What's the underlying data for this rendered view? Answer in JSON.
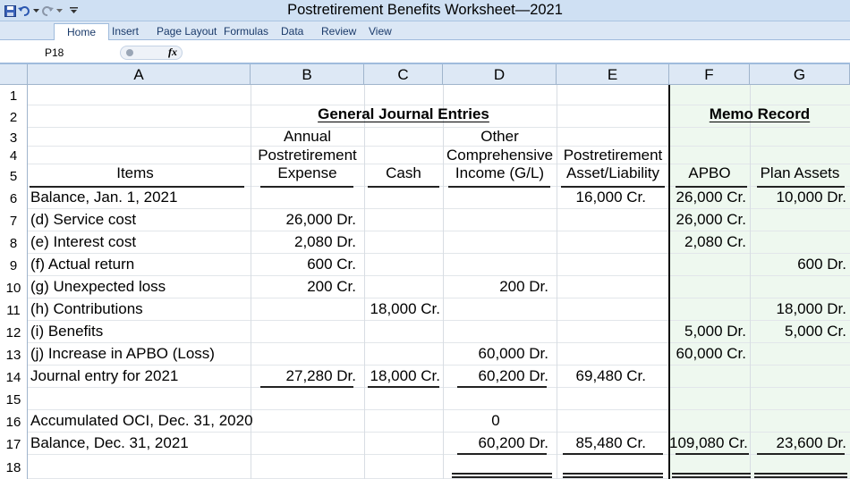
{
  "window": {
    "title": "Postretirement Benefits Worksheet—2021"
  },
  "ribbon": {
    "tabs": [
      "Home",
      "Insert",
      "Page Layout",
      "Formulas",
      "Data",
      "Review",
      "View"
    ],
    "active_tab": "Home"
  },
  "formula_bar": {
    "name_box": "P18",
    "fx_label": "fx"
  },
  "columns": [
    "A",
    "B",
    "C",
    "D",
    "E",
    "F",
    "G"
  ],
  "rows": [
    "1",
    "2",
    "3",
    "4",
    "5",
    "6",
    "7",
    "8",
    "9",
    "10",
    "11",
    "12",
    "13",
    "14",
    "15",
    "16",
    "17",
    "18"
  ],
  "headings": {
    "general_journal": "General Journal Entries",
    "memo_record": "Memo Record",
    "items": "Items",
    "b_line1": "Annual",
    "b_line2": "Postretirement",
    "b_line3": "Expense",
    "cash": "Cash",
    "d_line1": "Other",
    "d_line2": "Comprehensive",
    "d_line3": "Income (G/L)",
    "e_line1": "Postretirement",
    "e_line2": "Asset/Liability",
    "apbo": "APBO",
    "plan_assets": "Plan Assets"
  },
  "body": [
    {
      "row": 6,
      "A": "Balance, Jan. 1, 2021",
      "B": "",
      "C": "",
      "D": "",
      "E": "16,000 Cr.",
      "F": "26,000 Cr.",
      "G": "10,000 Dr."
    },
    {
      "row": 7,
      "A": "(d) Service cost",
      "B": "26,000 Dr.",
      "C": "",
      "D": "",
      "E": "",
      "F": "26,000 Cr.",
      "G": ""
    },
    {
      "row": 8,
      "A": "(e) Interest cost",
      "B": "2,080 Dr.",
      "C": "",
      "D": "",
      "E": "",
      "F": "2,080 Cr.",
      "G": ""
    },
    {
      "row": 9,
      "A": "(f) Actual return",
      "B": "600 Cr.",
      "C": "",
      "D": "",
      "E": "",
      "F": "",
      "G": "600 Dr."
    },
    {
      "row": 10,
      "A": "(g) Unexpected loss",
      "B": "200 Cr.",
      "C": "",
      "D": "200 Dr.",
      "E": "",
      "F": "",
      "G": ""
    },
    {
      "row": 11,
      "A": "(h) Contributions",
      "B": "",
      "C": "18,000 Cr.",
      "D": "",
      "E": "",
      "F": "",
      "G": "18,000 Dr."
    },
    {
      "row": 12,
      "A": "(i) Benefits",
      "B": "",
      "C": "",
      "D": "",
      "E": "",
      "F": "5,000 Dr.",
      "G": "5,000 Cr."
    },
    {
      "row": 13,
      "A": "(j) Increase in APBO (Loss)",
      "B": "",
      "C": "",
      "D": "60,000 Dr.",
      "E": "",
      "F": "60,000 Cr.",
      "G": ""
    },
    {
      "row": 14,
      "A": "Journal entry for 2021",
      "B": "27,280 Dr.",
      "C": "18,000 Cr.",
      "D": "60,200 Dr.",
      "E": "69,480 Cr.",
      "F": "",
      "G": ""
    },
    {
      "row": 15,
      "A": "",
      "B": "",
      "C": "",
      "D": "",
      "E": "",
      "F": "",
      "G": ""
    },
    {
      "row": 16,
      "A": "Accumulated OCI, Dec. 31, 2020",
      "B": "",
      "C": "",
      "D": "0",
      "E": "",
      "F": "",
      "G": ""
    },
    {
      "row": 17,
      "A": "Balance, Dec. 31, 2021",
      "B": "",
      "C": "",
      "D": "60,200 Dr.",
      "E": "85,480 Cr.",
      "F": "109,080 Cr.",
      "G": "23,600 Dr."
    }
  ]
}
